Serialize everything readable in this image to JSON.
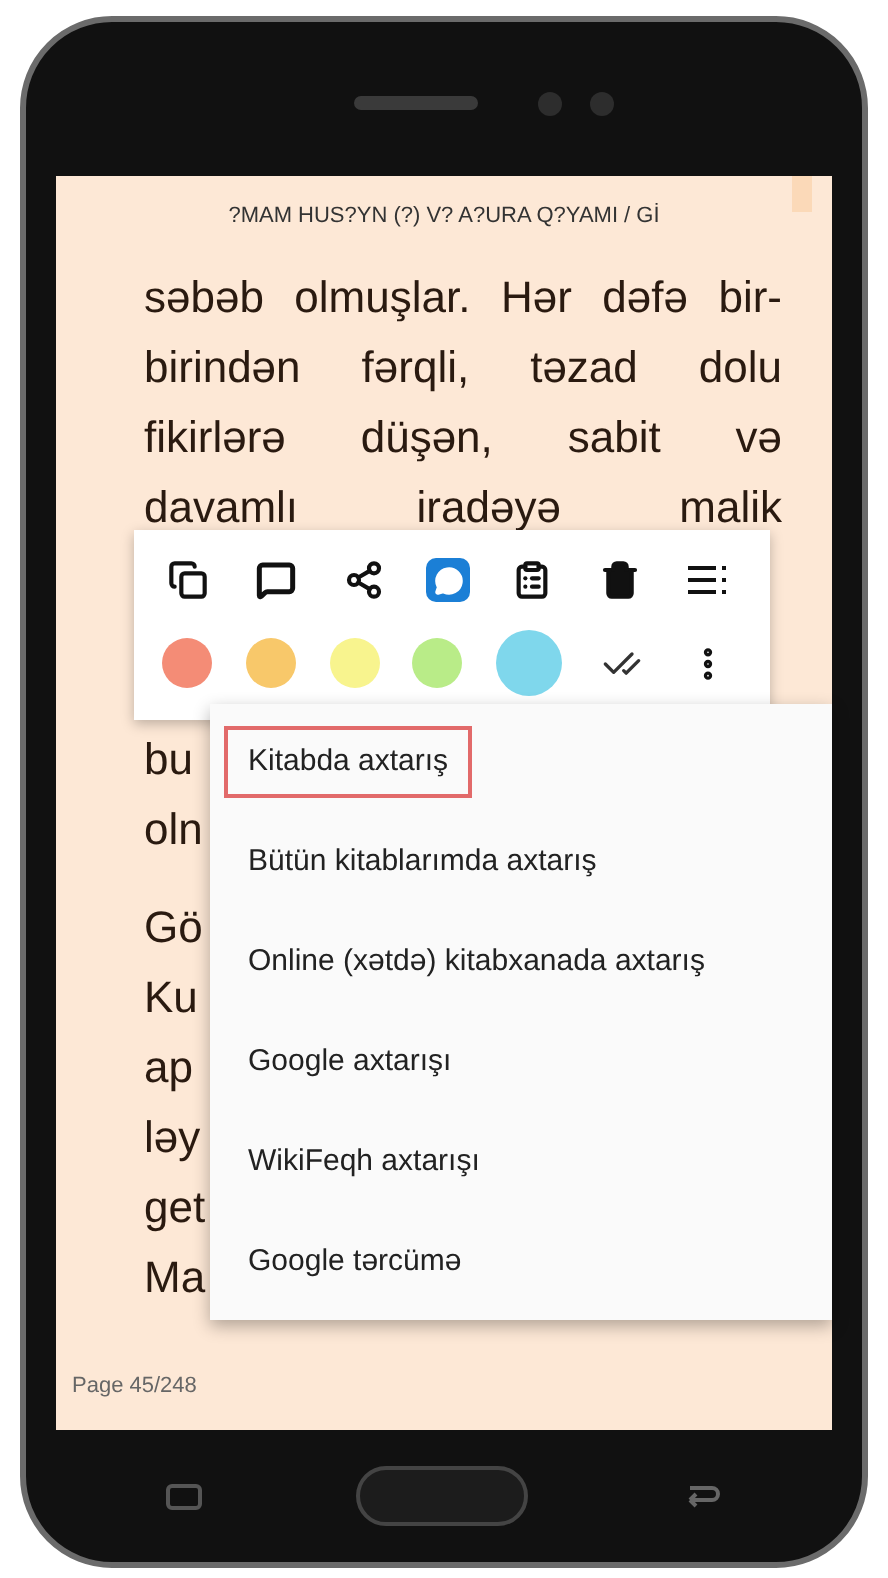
{
  "header": {
    "title": "?MAM HUS?YN (?) V? A?URA Q?YAMI / Gİ"
  },
  "paragraphs": [
    {
      "lines": [
        {
          "text": "səbəb olmuşlar. Hər dəfə bir-",
          "kind": "justified"
        },
        {
          "text": "birindən fərqli, təzad dolu",
          "kind": "justified"
        },
        {
          "text": "fikirlərə düşən, sabit və",
          "kind": "justified"
        },
        {
          "text": "davamlı iradəyə malik",
          "kind": "justified"
        }
      ]
    },
    {
      "lines": [
        {
          "text": "bu",
          "kind": "fragment"
        },
        {
          "text": "oln",
          "kind": "fragment"
        }
      ]
    },
    {
      "lines": [
        {
          "text": "Gö",
          "kind": "fragment"
        },
        {
          "text": "Ku",
          "kind": "fragment"
        },
        {
          "text": "ap",
          "kind": "fragment"
        },
        {
          "text": "ləy",
          "kind": "fragment"
        },
        {
          "text": "get",
          "kind": "fragment"
        },
        {
          "text": "Ma",
          "kind": "fragment"
        }
      ]
    }
  ],
  "highlight_colors": [
    {
      "color": "#f48c76",
      "selected": false
    },
    {
      "color": "#f8c86a",
      "selected": false
    },
    {
      "color": "#f8f48e",
      "selected": false
    },
    {
      "color": "#b9ec88",
      "selected": false
    },
    {
      "color": "#7fd7ec",
      "selected": true
    }
  ],
  "menu": [
    {
      "label": "Kitabda axtarış",
      "selected": true
    },
    {
      "label": "Bütün kitablarımda axtarış",
      "selected": false
    },
    {
      "label": "Online (xətdə) kitabxanada axtarış",
      "selected": false
    },
    {
      "label": "Google axtarışı",
      "selected": false
    },
    {
      "label": "WikiFeqh axtarışı",
      "selected": false
    },
    {
      "label": "Google tərcümə",
      "selected": false
    }
  ],
  "footer": {
    "page": "Page 45/248"
  }
}
